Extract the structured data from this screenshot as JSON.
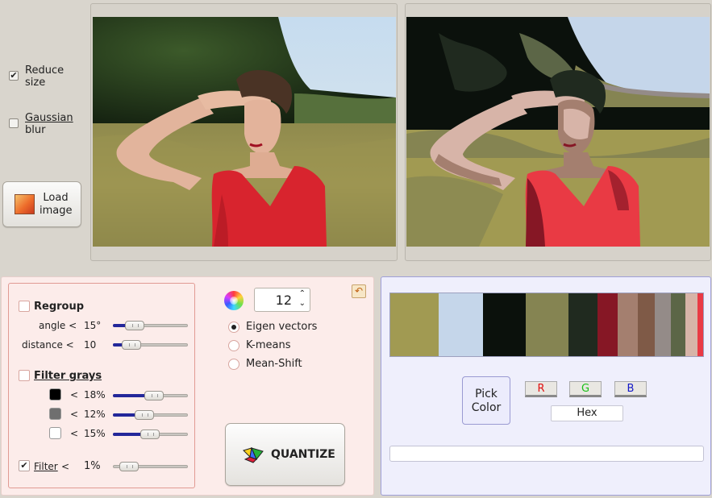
{
  "options": {
    "reduce_size": {
      "label_line1": "Reduce",
      "label_line2": "size",
      "checked": true
    },
    "gaussian_blur": {
      "label_line1": "Gaussian",
      "label_line2": "blur",
      "checked": false
    },
    "load_button": {
      "line1": "Load",
      "line2": "image"
    }
  },
  "regroup": {
    "label": "Regroup",
    "checked": false,
    "angle": {
      "label": "angle <",
      "value": "15°",
      "level": 0.2
    },
    "distance": {
      "label": "distance <",
      "value": "10",
      "level": 0.15
    }
  },
  "filter_grays": {
    "label": "Filter grays",
    "checked": false,
    "rows": [
      {
        "swatch_color": "#000000",
        "op": "<",
        "value": "18%",
        "level": 0.55
      },
      {
        "swatch_color": "#6f6f6f",
        "op": "<",
        "value": "12%",
        "level": 0.37
      },
      {
        "swatch_color": "#ffffff",
        "op": "<",
        "value": "15%",
        "level": 0.48
      }
    ]
  },
  "filter": {
    "label": "Filter",
    "op": "<",
    "value": "1%",
    "checked": true,
    "level": 0.1
  },
  "colors_count": "12",
  "methods": [
    {
      "label": "Eigen vectors",
      "selected": true
    },
    {
      "label": "K-means",
      "selected": false
    },
    {
      "label": "Mean-Shift",
      "selected": false
    }
  ],
  "quantize_label": "QUANTIZE",
  "palette": [
    {
      "color": "#a19a52",
      "weight": 60
    },
    {
      "color": "#c5d6ea",
      "weight": 54
    },
    {
      "color": "#0b110c",
      "weight": 53
    },
    {
      "color": "#858452",
      "weight": 53
    },
    {
      "color": "#202a1f",
      "weight": 36
    },
    {
      "color": "#861725",
      "weight": 25
    },
    {
      "color": "#a47f6f",
      "weight": 24
    },
    {
      "color": "#7f5a47",
      "weight": 21
    },
    {
      "color": "#948b88",
      "weight": 20
    },
    {
      "color": "#5c6647",
      "weight": 18
    },
    {
      "color": "#d7b4a8",
      "weight": 15
    },
    {
      "color": "#e93a44",
      "weight": 7
    }
  ],
  "pick_color": {
    "line1": "Pick",
    "line2": "Color"
  },
  "channels": {
    "r": "R",
    "g": "G",
    "b": "B",
    "hex": "Hex"
  },
  "colors": {
    "accent_blue": "#23279a",
    "panel_pink": "#fcecea",
    "panel_lavender": "#efeffc"
  }
}
